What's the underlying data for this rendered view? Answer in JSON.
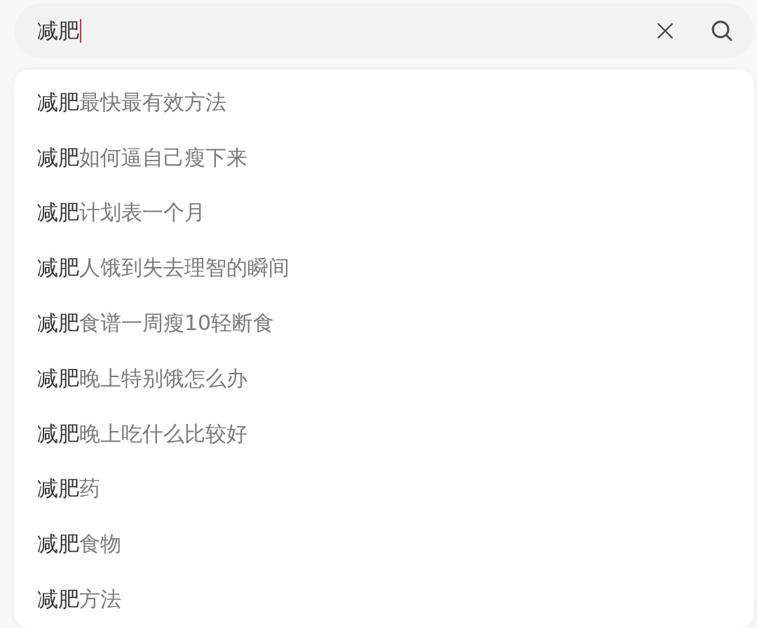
{
  "search": {
    "value": "减肥",
    "focused": true
  },
  "suggestions": [
    {
      "match": "减肥",
      "rest": "最快最有效方法"
    },
    {
      "match": "减肥",
      "rest": "如何逼自己瘦下来"
    },
    {
      "match": "减肥",
      "rest": "计划表一个月"
    },
    {
      "match": "减肥",
      "rest": "人饿到失去理智的瞬间"
    },
    {
      "match": "减肥",
      "rest": "食谱一周瘦10轻断食"
    },
    {
      "match": "减肥",
      "rest": "晚上特别饿怎么办"
    },
    {
      "match": "减肥",
      "rest": "晚上吃什么比较好"
    },
    {
      "match": "减肥",
      "rest": "药"
    },
    {
      "match": "减肥",
      "rest": "食物"
    },
    {
      "match": "减肥",
      "rest": "方法"
    }
  ]
}
